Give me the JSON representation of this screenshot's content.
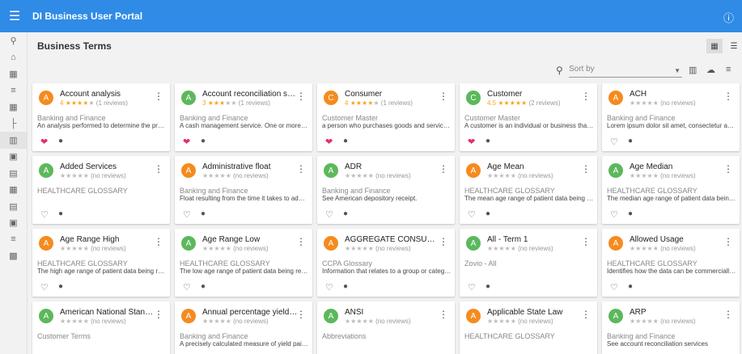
{
  "app": {
    "title": "DI Business User Portal"
  },
  "page": {
    "title": "Business Terms"
  },
  "sort": {
    "placeholder": "Sort by"
  },
  "colors": {
    "topbar": "#2f8be6",
    "avatar_orange": "#f58b1f",
    "avatar_green": "#5cb85c",
    "favorite": "#e0306d",
    "star": "#f5a623"
  },
  "sidebar": [
    "search-icon",
    "home-icon",
    "dashboard-icon",
    "list-icon",
    "table-icon",
    "hierarchy-icon",
    "glossary-icon",
    "catalog-icon",
    "clipboard-icon",
    "grid-icon",
    "document-icon",
    "report-icon",
    "menu-list-icon",
    "chart-icon"
  ],
  "cards": [
    {
      "letter": "A",
      "color": "orange",
      "title": "Account analysis",
      "rating": "4",
      "stars": 4,
      "reviews": "(1 reviews)",
      "category": "Banking and Finance",
      "desc": "An analysis performed to determine the profitabili...",
      "fav": true
    },
    {
      "letter": "A",
      "color": "green",
      "title": "Account reconciliation services",
      "rating": "3",
      "stars": 3,
      "reviews": "(1 reviews)",
      "category": "Banking and Finance",
      "desc": "A cash management service. One or more of a ser...",
      "fav": true
    },
    {
      "letter": "C",
      "color": "orange",
      "title": "Consumer",
      "rating": "4",
      "stars": 4,
      "reviews": "(1 reviews)",
      "category": "Customer Master",
      "desc": "a person who purchases goods and services for p...",
      "fav": true
    },
    {
      "letter": "C",
      "color": "green",
      "title": "Customer",
      "rating": "4.5",
      "stars": 5,
      "reviews": "(2 reviews)",
      "category": "Customer Master",
      "desc": "A customer is an individual or business that purch...",
      "fav": true
    },
    {
      "letter": "A",
      "color": "orange",
      "title": "ACH",
      "rating": "",
      "stars": 0,
      "reviews": "(no reviews)",
      "category": "Banking and Finance",
      "desc": "Lorem ipsum dolor sit amet, consectetur adipiscing",
      "fav": false
    },
    {
      "letter": "A",
      "color": "green",
      "title": "Added Services",
      "rating": "",
      "stars": 0,
      "reviews": "(no reviews)",
      "category": "HEALTHCARE GLOSSARY",
      "desc": "",
      "fav": false
    },
    {
      "letter": "A",
      "color": "orange",
      "title": "Administrative float",
      "rating": "",
      "stars": 0,
      "reviews": "(no reviews)",
      "category": "Banking and Finance",
      "desc": "Float resulting from the time it takes to administra...",
      "fav": false
    },
    {
      "letter": "A",
      "color": "green",
      "title": "ADR",
      "rating": "",
      "stars": 0,
      "reviews": "(no reviews)",
      "category": "Banking and Finance",
      "desc": "See American depository receipt.",
      "fav": false
    },
    {
      "letter": "A",
      "color": "orange",
      "title": "Age Mean",
      "rating": "",
      "stars": 0,
      "reviews": "(no reviews)",
      "category": "HEALTHCARE GLOSSARY",
      "desc": "The mean age range of patient data being request...",
      "fav": false
    },
    {
      "letter": "A",
      "color": "green",
      "title": "Age Median",
      "rating": "",
      "stars": 0,
      "reviews": "(no reviews)",
      "category": "HEALTHCARE GLOSSARY",
      "desc": "The median age range of patient data being reque...",
      "fav": false
    },
    {
      "letter": "A",
      "color": "orange",
      "title": "Age Range High",
      "rating": "",
      "stars": 0,
      "reviews": "(no reviews)",
      "category": "HEALTHCARE GLOSSARY",
      "desc": "The high age range of patient data being requested",
      "fav": false
    },
    {
      "letter": "A",
      "color": "green",
      "title": "Age Range Low",
      "rating": "",
      "stars": 0,
      "reviews": "(no reviews)",
      "category": "HEALTHCARE GLOSSARY",
      "desc": "The low age range of patient data being requested",
      "fav": false
    },
    {
      "letter": "A",
      "color": "orange",
      "title": "AGGREGATE CONSUMER INF...",
      "rating": "",
      "stars": 0,
      "reviews": "(no reviews)",
      "category": "CCPA Glossary",
      "desc": "Information that relates to a group or category of ...",
      "fav": false
    },
    {
      "letter": "A",
      "color": "green",
      "title": "All - Term 1",
      "rating": "",
      "stars": 0,
      "reviews": "(no reviews)",
      "category": "Zovio - All",
      "desc": "",
      "fav": false
    },
    {
      "letter": "A",
      "color": "orange",
      "title": "Allowed Usage",
      "rating": "",
      "stars": 0,
      "reviews": "(no reviews)",
      "category": "HEALTHCARE GLOSSARY",
      "desc": "Identifies how the data can be commercially used",
      "fav": false
    },
    {
      "letter": "A",
      "color": "green",
      "title": "American National Standards I...",
      "rating": "",
      "stars": 0,
      "reviews": "(no reviews)",
      "category": "Customer Terms",
      "desc": "",
      "fav": false
    },
    {
      "letter": "A",
      "color": "orange",
      "title": "Annual percentage yield APY",
      "rating": "",
      "stars": 0,
      "reviews": "(no reviews)",
      "category": "Banking and Finance",
      "desc": "A precisely calculated measure of yield paid on a ...",
      "fav": false
    },
    {
      "letter": "A",
      "color": "green",
      "title": "ANSI",
      "rating": "",
      "stars": 0,
      "reviews": "(no reviews)",
      "category": "Abbreviations",
      "desc": "",
      "fav": false
    },
    {
      "letter": "A",
      "color": "orange",
      "title": "Applicable State Law",
      "rating": "",
      "stars": 0,
      "reviews": "(no reviews)",
      "category": "HEALTHCARE GLOSSARY",
      "desc": "",
      "fav": false
    },
    {
      "letter": "A",
      "color": "green",
      "title": "ARP",
      "rating": "",
      "stars": 0,
      "reviews": "(no reviews)",
      "category": "Banking and Finance",
      "desc": "See account reconciliation services",
      "fav": false
    }
  ]
}
